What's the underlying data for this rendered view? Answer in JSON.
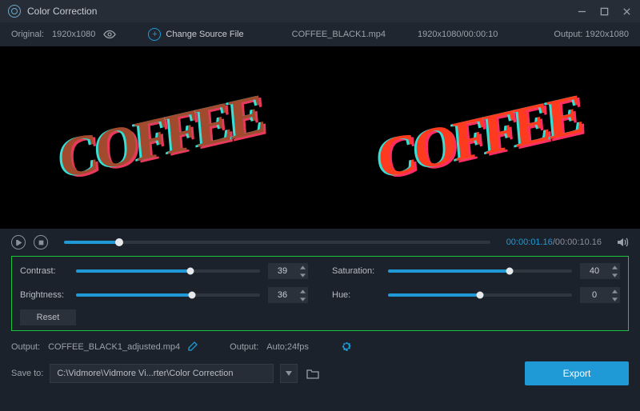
{
  "window": {
    "title": "Color Correction"
  },
  "header": {
    "original_label": "Original:",
    "original_res": "1920x1080",
    "change_label": "Change Source File",
    "filename": "COFFEE_BLACK1.mp4",
    "source_res_time": "1920x1080/00:00:10",
    "output_label": "Output:",
    "output_res": "1920x1080"
  },
  "preview": {
    "word": "COFFEE"
  },
  "playback": {
    "seek_percent": 13,
    "current": "00:00:01.16",
    "duration": "00:00:10.16"
  },
  "controls": {
    "contrast": {
      "label": "Contrast:",
      "value": 39,
      "pos_percent": 62
    },
    "brightness": {
      "label": "Brightness:",
      "value": 36,
      "pos_percent": 63
    },
    "saturation": {
      "label": "Saturation:",
      "value": 40,
      "pos_percent": 66
    },
    "hue": {
      "label": "Hue:",
      "value": 0,
      "pos_percent": 50
    },
    "reset_label": "Reset"
  },
  "output": {
    "label": "Output:",
    "filename": "COFFEE_BLACK1_adjusted.mp4",
    "fmt_label": "Output:",
    "fmt_value": "Auto;24fps"
  },
  "save": {
    "label": "Save to:",
    "path": "C:\\Vidmore\\Vidmore Vi...rter\\Color Correction",
    "export_label": "Export"
  }
}
